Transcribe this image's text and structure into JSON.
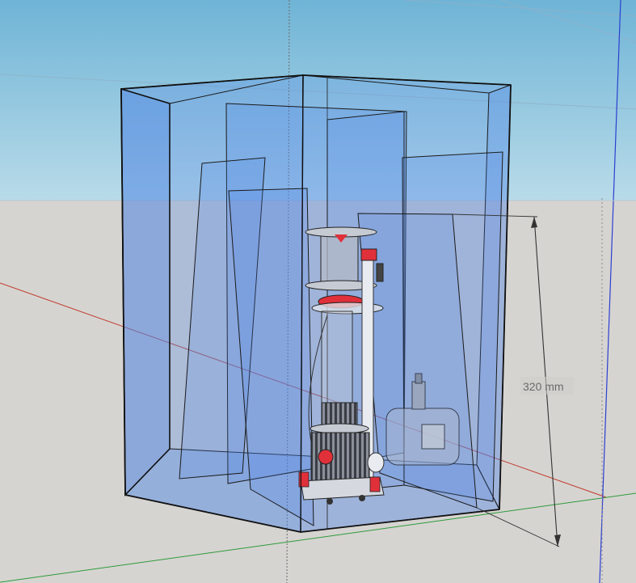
{
  "viewport": {
    "sky_top_color": "#6fb4d6",
    "sky_bottom_color": "#b9dbe9",
    "ground_color": "#d6d4d1"
  },
  "model": {
    "glass_color": "#4f86e6",
    "edge_color": "#111111",
    "accent_color": "#e0303a"
  },
  "axes": {
    "red_axis_color": "#c0392b",
    "green_axis_color": "#2e9a3a",
    "blue_axis_color": "#2b3fd1"
  },
  "dimension": {
    "label": "320 mm"
  }
}
